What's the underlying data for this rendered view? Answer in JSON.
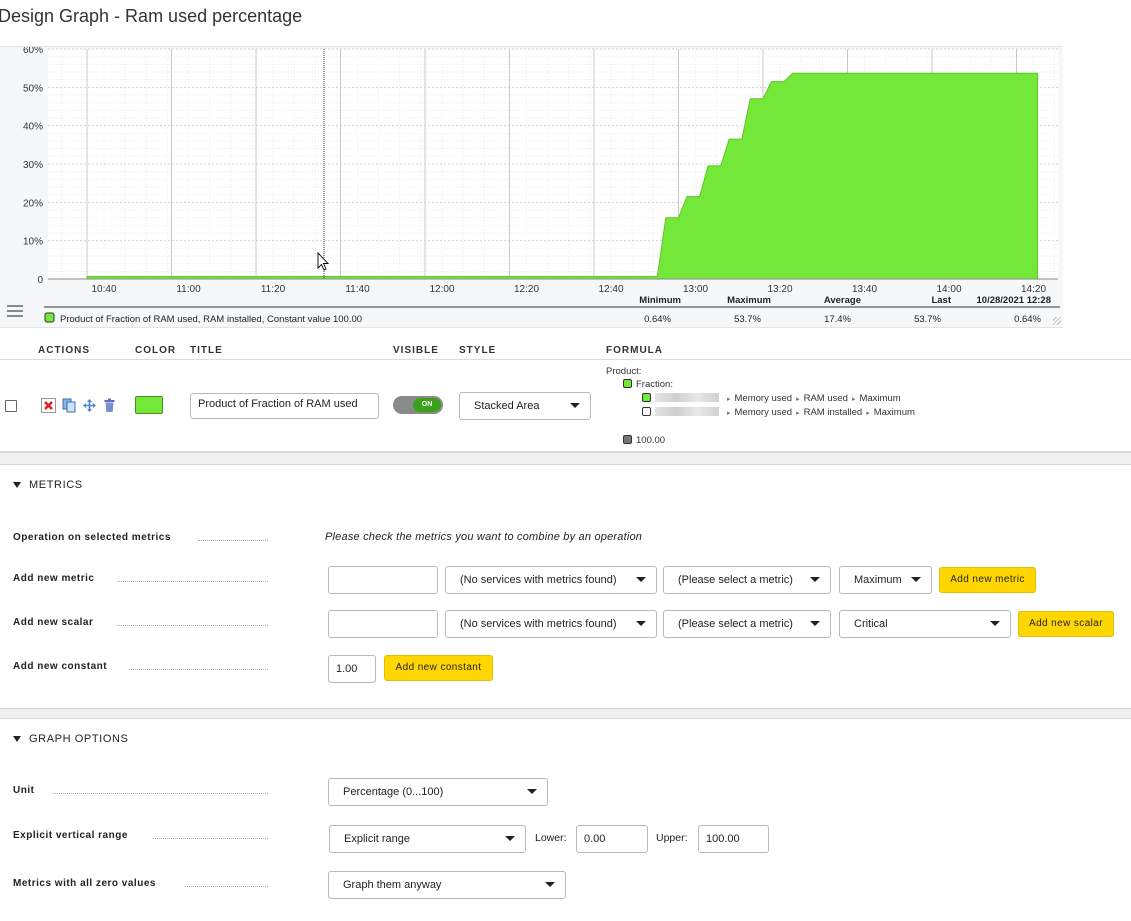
{
  "page": {
    "title": "Design Graph - Ram used percentage"
  },
  "graph": {
    "y_ticks": [
      "60%",
      "50%",
      "40%",
      "30%",
      "20%",
      "10%",
      "0"
    ],
    "x_ticks": [
      "10:40",
      "11:00",
      "11:20",
      "11:40",
      "12:00",
      "12:20",
      "12:40",
      "13:00",
      "13:20",
      "13:40",
      "14:00",
      "14:20"
    ],
    "stats_headers": {
      "minimum": "Minimum",
      "maximum": "Maximum",
      "average": "Average",
      "last": "Last",
      "timestamp": "10/28/2021 12:28"
    },
    "legend": {
      "label": "Product of Fraction of RAM used, RAM installed, Constant value 100.00",
      "minimum": "0.64%",
      "maximum": "53.7%",
      "average": "17.4%",
      "last": "53.7%",
      "at_timestamp": "0.64%"
    },
    "series_color": "#73e839"
  },
  "chart_data": {
    "type": "area",
    "title": "",
    "xlabel": "",
    "ylabel": "",
    "ylim": [
      0,
      60
    ],
    "x_ticks": [
      "10:40",
      "11:00",
      "11:20",
      "11:40",
      "12:00",
      "12:20",
      "12:40",
      "13:00",
      "13:20",
      "13:40",
      "14:00",
      "14:20"
    ],
    "series": [
      {
        "name": "Product of Fraction of RAM used, RAM installed, Constant value 100.00",
        "color": "#73e839",
        "points": [
          [
            "10:40",
            0.64
          ],
          [
            "12:55",
            0.64
          ],
          [
            "12:57",
            16
          ],
          [
            "13:00",
            16
          ],
          [
            "13:02",
            21.5
          ],
          [
            "13:05",
            21.5
          ],
          [
            "13:07",
            29.5
          ],
          [
            "13:10",
            29.5
          ],
          [
            "13:12",
            36.5
          ],
          [
            "13:15",
            36.5
          ],
          [
            "13:17",
            47
          ],
          [
            "13:20",
            47
          ],
          [
            "13:22",
            51.5
          ],
          [
            "13:25",
            51.5
          ],
          [
            "13:27",
            53.7
          ],
          [
            "14:25",
            53.7
          ]
        ]
      }
    ]
  },
  "columns": {
    "actions": "ACTIONS",
    "color": "COLOR",
    "title": "TITLE",
    "visible": "VISIBLE",
    "style": "STYLE",
    "formula": "FORMULA"
  },
  "metric_row": {
    "title_value": "Product of Fraction of RAM used",
    "visible_label": "ON",
    "style_value": "Stacked Area",
    "color": "#73e839",
    "formula": {
      "product_label": "Product:",
      "fraction_label": "Fraction:",
      "line1": [
        "Memory used",
        "RAM used",
        "Maximum"
      ],
      "line2": [
        "Memory used",
        "RAM installed",
        "Maximum"
      ],
      "constant": "100.00"
    }
  },
  "metrics_section": {
    "heading": "METRICS",
    "operation_label": "Operation on selected metrics",
    "operation_hint": "Please check the metrics you want to combine by an operation",
    "add_metric_label": "Add new metric",
    "add_scalar_label": "Add new scalar",
    "add_constant_label": "Add new constant",
    "services_placeholder": "(No services with metrics found)",
    "metric_placeholder": "(Please select a metric)",
    "consolidation_value": "Maximum",
    "scalar_value": "Critical",
    "constant_value": "1.00",
    "add_metric_button": "Add new metric",
    "add_scalar_button": "Add new scalar",
    "add_constant_button": "Add new constant"
  },
  "graph_options": {
    "heading": "GRAPH OPTIONS",
    "unit_label": "Unit",
    "unit_value": "Percentage (0...100)",
    "range_label": "Explicit vertical range",
    "range_value": "Explicit range",
    "lower_label": "Lower:",
    "lower_value": "0.00",
    "upper_label": "Upper:",
    "upper_value": "100.00",
    "zero_label": "Metrics with all zero values",
    "zero_value": "Graph them anyway"
  }
}
